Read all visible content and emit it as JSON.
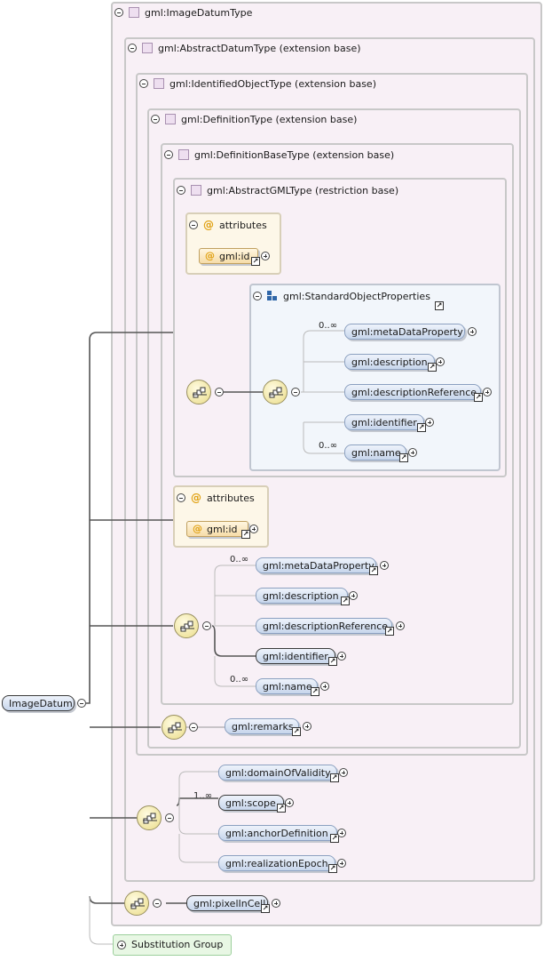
{
  "root": {
    "label": "ImageDatum"
  },
  "types": {
    "image_datum": "gml:ImageDatumType",
    "abstract_datum": "gml:AbstractDatumType (extension base)",
    "identified_object": "gml:IdentifiedObjectType (extension base)",
    "definition": "gml:DefinitionType (extension base)",
    "definition_base": "gml:DefinitionBaseType (extension base)",
    "abstract_gml": "gml:AbstractGMLType (restriction base)"
  },
  "attributes": {
    "label": "attributes",
    "id_label": "gml:id",
    "icon": "at-sign"
  },
  "standard_group": {
    "label": "gml:StandardObjectProperties",
    "items": [
      {
        "label": "gml:metaDataProperty",
        "card": "0..∞"
      },
      {
        "label": "gml:description",
        "card": ""
      },
      {
        "label": "gml:descriptionReference",
        "card": ""
      },
      {
        "label": "gml:identifier",
        "card": ""
      },
      {
        "label": "gml:name",
        "card": "0..∞"
      }
    ]
  },
  "definition_seq": {
    "items": [
      {
        "label": "gml:metaDataProperty",
        "card": "0..∞"
      },
      {
        "label": "gml:description",
        "card": ""
      },
      {
        "label": "gml:descriptionReference",
        "card": ""
      },
      {
        "label": "gml:identifier",
        "card": ""
      },
      {
        "label": "gml:name",
        "card": "0..∞"
      }
    ]
  },
  "remarks": {
    "label": "gml:remarks"
  },
  "datum_seq": {
    "items": [
      {
        "label": "gml:domainOfValidity",
        "card": ""
      },
      {
        "label": "gml:scope",
        "card": "1..∞"
      },
      {
        "label": "gml:anchorDefinition",
        "card": ""
      },
      {
        "label": "gml:realizationEpoch",
        "card": ""
      }
    ]
  },
  "pixel_in_cell": {
    "label": "gml:pixelInCell"
  },
  "substitution": {
    "label": "Substitution Group"
  },
  "colors": {
    "element": "#c7d6ec",
    "type_frame": "#f8f0f6",
    "attr_frame": "#fdf7e8",
    "group_frame": "#f2f6fb",
    "compositor": "#eadc8a",
    "substitution": "#e8f7e4"
  }
}
